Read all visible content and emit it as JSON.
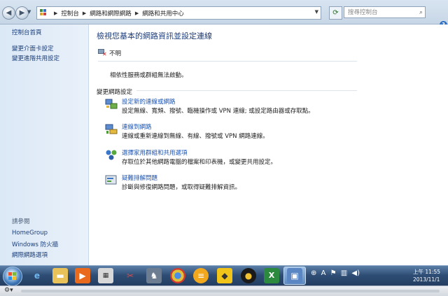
{
  "address_bar": {
    "back_glyph": "◀",
    "forward_glyph": "▶",
    "crumbs": [
      "控制台",
      "網路和網際網路",
      "網路和共用中心"
    ],
    "search_placeholder": "搜尋控制台"
  },
  "sidebar": {
    "home_link": "控制台首頁",
    "tasks": [
      "變更介面卡設定",
      "變更進階共用設定"
    ],
    "see_also_label": "請參閱",
    "see_also": [
      "HomeGroup",
      "Windows 防火牆",
      "網際網路選項"
    ]
  },
  "main": {
    "title": "檢視您基本的網路資訊並設定連線",
    "network_name": "不明",
    "status_text": "相依性服務或群組無法啟動。",
    "section_label": "變更網路設定",
    "tasks": [
      {
        "link": "設定新的連線或網路",
        "desc": "設定無線、寬頻、撥號、臨機操作或 VPN 連線; 或設定路由器或存取點。",
        "icon": "new-connection-icon"
      },
      {
        "link": "連線到網路",
        "desc": "連線或重新連線到無線、有線、撥號或 VPN 網路連線。",
        "icon": "connect-network-icon"
      },
      {
        "link": "選擇家用群組和共用選項",
        "desc": "存取位於其他網路電腦的檔案和印表機，或變更共用設定。",
        "icon": "homegroup-icon"
      },
      {
        "link": "疑難排解問題",
        "desc": "診斷與修復網路問題，或取得疑難排解資訊。",
        "icon": "troubleshoot-icon"
      }
    ]
  },
  "taskbar": {
    "clock_time": "上午 11:55",
    "clock_date": "2013/11/1",
    "tray_icons": [
      "language-icon",
      "ime-a-icon",
      "flag-icon",
      "network-icon",
      "volume-icon"
    ]
  },
  "colors": {
    "link": "#1c55b4",
    "title": "#1e3d7a",
    "sidebar_bg": "#dbe8f6",
    "taskbar": "#2f4e75"
  }
}
